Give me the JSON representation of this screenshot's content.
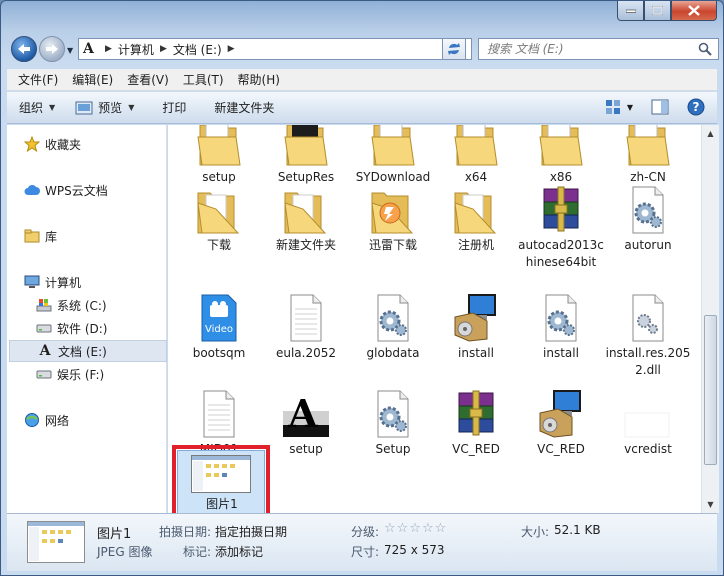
{
  "window": {
    "address": {
      "crumbs": [
        "计算机",
        "文档 (E:)"
      ]
    },
    "search": {
      "placeholder": "搜索 文档 (E:)"
    }
  },
  "menu": [
    "文件(F)",
    "编辑(E)",
    "查看(V)",
    "工具(T)",
    "帮助(H)"
  ],
  "commands": {
    "organize": "组织",
    "preview": "预览",
    "print": "打印",
    "new_folder": "新建文件夹"
  },
  "navpane": {
    "favorites": "收藏夹",
    "wps": "WPS云文档",
    "library": "库",
    "computer": "计算机",
    "drive_c": "系统 (C:)",
    "drive_d": "软件 (D:)",
    "drive_e": "文档 (E:)",
    "drive_f": "娱乐 (F:)",
    "network": "网络"
  },
  "files": [
    {
      "name": "setup",
      "type": "folder"
    },
    {
      "name": "SetupRes",
      "type": "folder-dark"
    },
    {
      "name": "SYDownload",
      "type": "folder"
    },
    {
      "name": "x64",
      "type": "folder"
    },
    {
      "name": "x86",
      "type": "folder"
    },
    {
      "name": "zh-CN",
      "type": "folder"
    },
    {
      "name": "下载",
      "type": "folder-open"
    },
    {
      "name": "新建文件夹",
      "type": "folder-open"
    },
    {
      "name": "迅雷下载",
      "type": "folder-thunder"
    },
    {
      "name": "注册机",
      "type": "folder-open"
    },
    {
      "name": "autocad2013chinese64bit",
      "type": "winrar"
    },
    {
      "name": "autorun",
      "type": "gear"
    },
    {
      "name": "bootsqm",
      "type": "video"
    },
    {
      "name": "eula.2052",
      "type": "doc"
    },
    {
      "name": "globdata",
      "type": "gear"
    },
    {
      "name": "install",
      "type": "installer"
    },
    {
      "name": "install",
      "type": "gear"
    },
    {
      "name": "install.res.2052.dll",
      "type": "dll"
    },
    {
      "name": "MID01",
      "type": "doc"
    },
    {
      "name": "setup",
      "type": "font"
    },
    {
      "name": "Setup",
      "type": "gear"
    },
    {
      "name": "VC_RED",
      "type": "winrar"
    },
    {
      "name": "VC_RED",
      "type": "installer"
    },
    {
      "name": "vcredist",
      "type": "blank"
    }
  ],
  "selected_file": {
    "name": "图片1"
  },
  "video_badge": "Video",
  "details": {
    "name": "图片1",
    "type": "JPEG 图像",
    "date_label": "拍摄日期:",
    "date_value": "指定拍摄日期",
    "tags_label": "标记:",
    "tags_value": "添加标记",
    "rating_label": "分级:",
    "rating_stars": "☆☆☆☆☆",
    "dims_label": "尺寸:",
    "dims_value": "725 x 573",
    "size_label": "大小:",
    "size_value": "52.1 KB"
  },
  "colors": {
    "accent": "#3c7fb1",
    "selection": "#cde3f8",
    "annotation": "#e0202a"
  }
}
